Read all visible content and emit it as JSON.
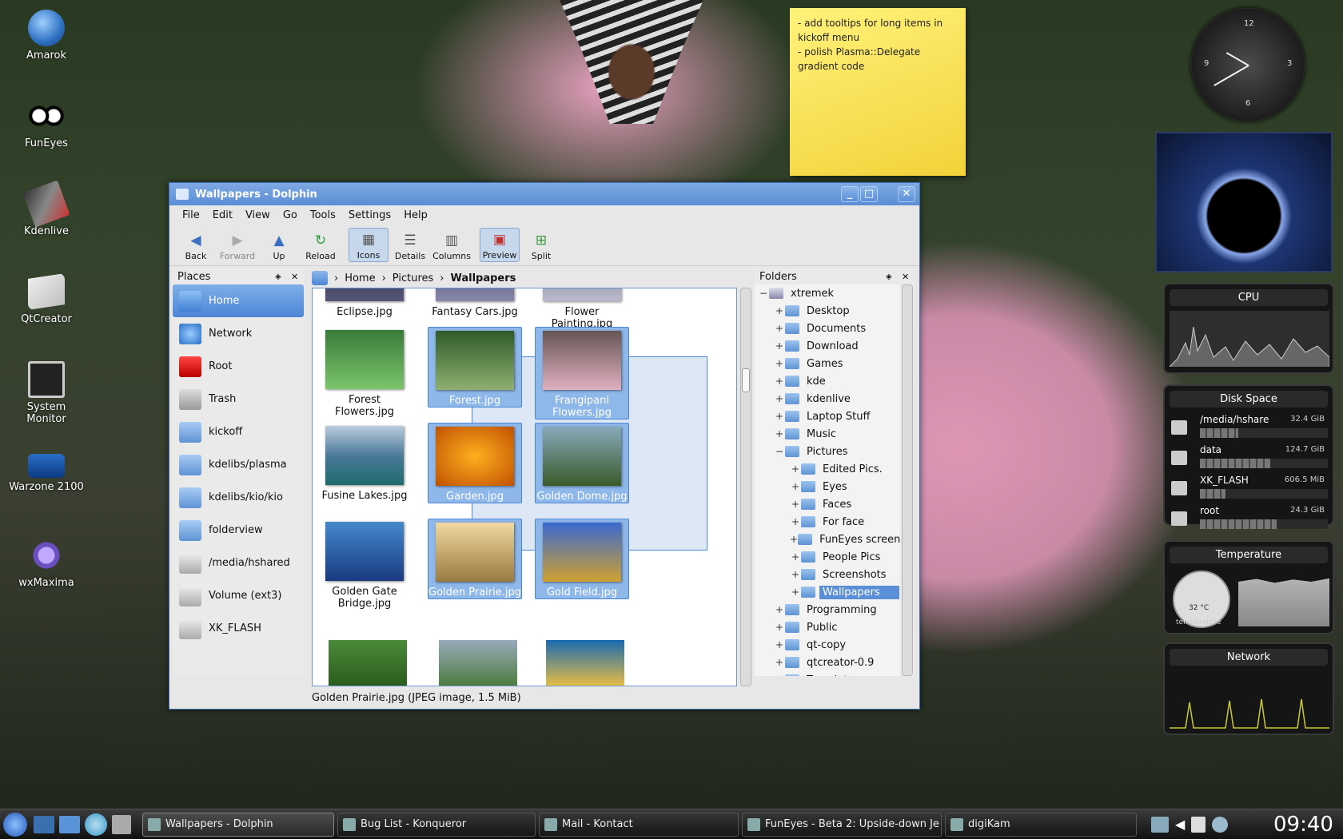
{
  "desktop_icons": [
    {
      "label": "Amarok",
      "icon": "amarok-wolf-icon"
    },
    {
      "label": "FunEyes",
      "icon": "funeyes-icon"
    },
    {
      "label": "Kdenlive",
      "icon": "kdenlive-icon"
    },
    {
      "label": "QtCreator",
      "icon": "qtcreator-icon"
    },
    {
      "label": "System Monitor",
      "icon": "system-monitor-icon"
    },
    {
      "label": "Warzone 2100",
      "icon": "warzone-icon"
    },
    {
      "label": "wxMaxima",
      "icon": "wxmaxima-icon"
    }
  ],
  "note": {
    "lines": [
      " - add tooltips for long items in kickoff menu",
      " - polish Plasma::Delegate gradient code"
    ]
  },
  "clock": {
    "hour": "12",
    "three": "3",
    "six": "6",
    "nine": "9"
  },
  "cpu": {
    "title": "CPU"
  },
  "disk": {
    "title": "Disk Space",
    "items": [
      {
        "name": "/media/hshare",
        "size": "32.4 GiB",
        "fill": 0.3
      },
      {
        "name": "data",
        "size": "124.7 GiB",
        "fill": 0.55
      },
      {
        "name": "XK_FLASH",
        "size": "606.5 MiB",
        "fill": 0.2
      },
      {
        "name": "root",
        "size": "24.3 GiB",
        "fill": 0.6
      }
    ]
  },
  "temperature": {
    "title": "Temperature",
    "value": "32 °C",
    "label": "temperature"
  },
  "network": {
    "title": "Network"
  },
  "window": {
    "title": "Wallpapers - Dolphin",
    "menu": [
      "File",
      "Edit",
      "View",
      "Go",
      "Tools",
      "Settings",
      "Help"
    ],
    "toolbar": [
      {
        "label": "Back",
        "icon": "back-arrow-icon"
      },
      {
        "label": "Forward",
        "icon": "forward-arrow-icon"
      },
      {
        "label": "Up",
        "icon": "up-arrow-icon"
      },
      {
        "label": "Reload",
        "icon": "reload-icon"
      },
      {
        "label": "Icons",
        "icon": "icons-view-icon"
      },
      {
        "label": "Details",
        "icon": "details-view-icon"
      },
      {
        "label": "Columns",
        "icon": "columns-view-icon"
      },
      {
        "label": "Preview",
        "icon": "preview-icon"
      },
      {
        "label": "Split",
        "icon": "split-icon"
      }
    ],
    "places": {
      "title": "Places",
      "items": [
        "Home",
        "Network",
        "Root",
        "Trash",
        "kickoff",
        "kdelibs/plasma",
        "kdelibs/kio/kio",
        "folderview",
        "/media/hshared",
        "Volume (ext3)",
        "XK_FLASH"
      ]
    },
    "breadcrumb": [
      "Home",
      "Pictures",
      "Wallpapers"
    ],
    "files": [
      {
        "name": "Eclipse.jpg"
      },
      {
        "name": "Fantasy Cars.jpg"
      },
      {
        "name": "Flower Painting.jpg"
      },
      {
        "name": "Forest Flowers.jpg"
      },
      {
        "name": "Forest.jpg"
      },
      {
        "name": "Frangipani Flowers.jpg"
      },
      {
        "name": "Fusine Lakes.jpg"
      },
      {
        "name": "Garden.jpg"
      },
      {
        "name": "Golden Dome.jpg"
      },
      {
        "name": "Golden Gate Bridge.jpg"
      },
      {
        "name": "Golden Prairie.jpg"
      },
      {
        "name": "Gold Field.jpg"
      }
    ],
    "status": "Golden Prairie.jpg (JPEG image, 1.5 MiB)",
    "folders": {
      "title": "Folders",
      "tree": [
        "xtremek",
        "Desktop",
        "Documents",
        "Download",
        "Games",
        "kde",
        "kdenlive",
        "Laptop Stuff",
        "Music",
        "Pictures",
        "Edited Pics.",
        "Eyes",
        "Faces",
        "For face",
        "FunEyes screensh",
        "People Pics",
        "Screenshots",
        "Wallpapers",
        "Programming",
        "Public",
        "qt-copy",
        "qtcreator-0.9",
        "Templates"
      ]
    }
  },
  "taskbar": {
    "tasks": [
      "Wallpapers - Dolphin",
      "Bug List - Konqueror",
      "Mail - Kontact",
      "FunEyes - Beta 2: Upside-down Je",
      "digiKam"
    ],
    "time": "09:40"
  }
}
